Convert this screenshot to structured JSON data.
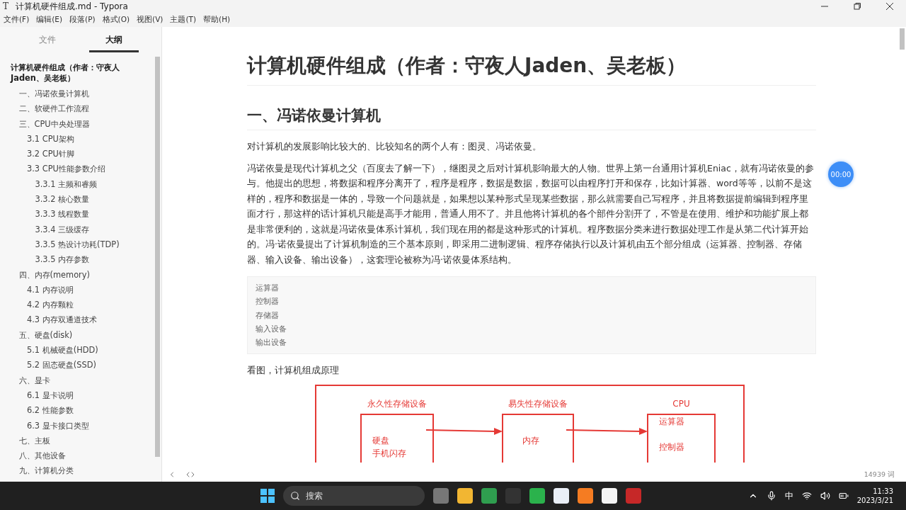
{
  "window": {
    "icon_letter": "T",
    "title": "计算机硬件组成.md - Typora"
  },
  "menu": [
    "文件(F)",
    "编辑(E)",
    "段落(P)",
    "格式(O)",
    "视图(V)",
    "主题(T)",
    "帮助(H)"
  ],
  "sidebar": {
    "tabs": [
      {
        "label": "文件",
        "selected": false
      },
      {
        "label": "大纲",
        "selected": true
      }
    ],
    "outline": [
      {
        "label": "计算机硬件组成（作者：守夜人Jaden、吴老板）",
        "children": [
          {
            "label": "一、冯诺依曼计算机"
          },
          {
            "label": "二、软硬件工作流程"
          },
          {
            "label": "三、CPU中央处理器",
            "children": [
              {
                "label": "3.1 CPU架构"
              },
              {
                "label": "3.2 CPU针脚"
              },
              {
                "label": "3.3 CPU性能参数介绍",
                "children": [
                  {
                    "label": "3.3.1 主频和睿频"
                  },
                  {
                    "label": "3.3.2 核心数量"
                  },
                  {
                    "label": "3.3.3 线程数量"
                  },
                  {
                    "label": "3.3.4 三级缓存"
                  },
                  {
                    "label": "3.3.5 热设计功耗(TDP)"
                  },
                  {
                    "label": "3.3.5 内存参数"
                  }
                ]
              }
            ]
          },
          {
            "label": "四、内存(memory)",
            "children": [
              {
                "label": "4.1 内存说明"
              },
              {
                "label": "4.2 内存颗粒"
              },
              {
                "label": "4.3 内存双通道技术"
              }
            ]
          },
          {
            "label": "五、硬盘(disk)",
            "children": [
              {
                "label": "5.1 机械硬盘(HDD)"
              },
              {
                "label": "5.2 固态硬盘(SSD)"
              }
            ]
          },
          {
            "label": "六、显卡",
            "children": [
              {
                "label": "6.1 显卡说明"
              },
              {
                "label": "6.2 性能参数"
              },
              {
                "label": "6.3 显卡接口类型"
              }
            ]
          },
          {
            "label": "七、主板"
          },
          {
            "label": "八、其他设备"
          },
          {
            "label": "九、计算机分类"
          }
        ]
      }
    ]
  },
  "document": {
    "title": "计算机硬件组成（作者：守夜人Jaden、吴老板）",
    "blocks": [
      {
        "kind": "heading",
        "text": "一、冯诺依曼计算机"
      },
      {
        "kind": "paragraph",
        "text": "对计算机的发展影响比较大的、比较知名的两个人有：图灵、冯诺依曼。"
      },
      {
        "kind": "paragraph",
        "text": "冯诺依曼是现代计算机之父（百度去了解一下），继图灵之后对计算机影响最大的人物。世界上第一台通用计算机Eniac，就有冯诺依曼的参与。他提出的思想，将数据和程序分离开了，程序是程序，数据是数据，数据可以由程序打开和保存，比如计算器、word等等，以前不是这样的，程序和数据是一体的，导致一个问题就是，如果想以某种形式呈现某些数据，那么就需要自己写程序，并且将数据提前编辑到程序里面才行，那这样的话计算机只能是高手才能用，普通人用不了。并且他将计算机的各个部件分割开了，不管是在使用、维护和功能扩展上都是非常便利的，这就是冯诺依曼体系计算机，我们现在用的都是这种形式的计算机。程序数据分类来进行数据处理工作是从第二代计算开始的。冯·诺依曼提出了计算机制造的三个基本原则，即采用二进制逻辑、程序存储执行以及计算机由五个部分组成（运算器、控制器、存储器、输入设备、输出设备），这套理论被称为冯·诺依曼体系结构。"
      },
      {
        "kind": "code",
        "lines": [
          "运算器",
          "控制器",
          "存储器",
          "输入设备",
          "输出设备"
        ]
      },
      {
        "kind": "paragraph",
        "text": "看图，计算机组成原理"
      },
      {
        "kind": "diagram",
        "nodes": [
          {
            "title": "永久性存储设备",
            "items": [
              "硬盘",
              "手机闪存"
            ]
          },
          {
            "title": "易失性存储设备",
            "items": [
              "内存"
            ]
          },
          {
            "title": "CPU",
            "items": [
              "运算器",
              "控制器"
            ]
          }
        ]
      }
    ]
  },
  "timer": "00:00",
  "status_bar": {
    "word_count": "14939 词"
  },
  "taskbar": {
    "search_placeholder": "搜索",
    "ime": "中",
    "time": "11:33",
    "date": "2023/3/21"
  }
}
